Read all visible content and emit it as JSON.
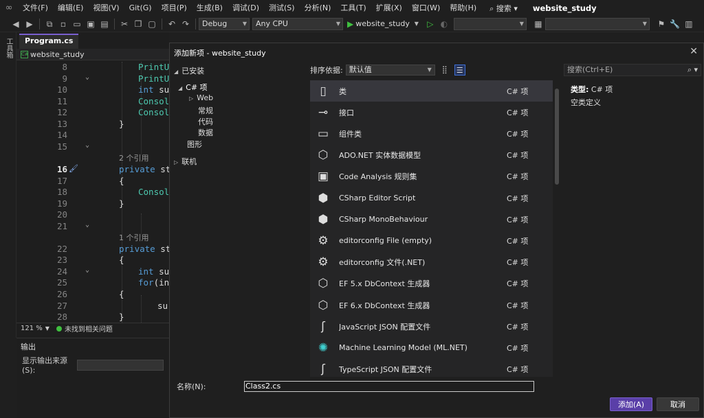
{
  "menubar": {
    "items": [
      "文件(F)",
      "编辑(E)",
      "视图(V)",
      "Git(G)",
      "项目(P)",
      "生成(B)",
      "调试(D)",
      "测试(S)",
      "分析(N)",
      "工具(T)",
      "扩展(X)",
      "窗口(W)",
      "帮助(H)"
    ],
    "search_label": "搜索",
    "app_title": "website_study"
  },
  "toolbar": {
    "config": "Debug",
    "platform": "Any CPU",
    "run_target": "website_study"
  },
  "side_panel_label": "工具箱",
  "editor": {
    "tab_name": "Program.cs",
    "nav_project": "website_study",
    "zoom": "121 %",
    "status": "未找到相关问题",
    "lines": [
      {
        "n": "8",
        "text": "PrintU"
      },
      {
        "n": "9",
        "text": "PrintU"
      },
      {
        "n": "10",
        "kw": "int",
        "text": " su"
      },
      {
        "n": "11",
        "text": "Consol"
      },
      {
        "n": "12",
        "text": "Consol"
      },
      {
        "n": "13",
        "text": "}"
      },
      {
        "n": "14",
        "text": ""
      },
      {
        "n": "15",
        "text": ""
      },
      {
        "refs": "2 个引用"
      },
      {
        "n": "16",
        "kw": "private",
        "text": " st",
        "current": true
      },
      {
        "n": "17",
        "text": "{"
      },
      {
        "n": "18",
        "text": "Consol"
      },
      {
        "n": "19",
        "text": "}"
      },
      {
        "n": "20",
        "text": ""
      },
      {
        "n": "21",
        "text": ""
      },
      {
        "refs": "1 个引用"
      },
      {
        "n": "22",
        "kw": "private",
        "text": " st"
      },
      {
        "n": "23",
        "text": "{"
      },
      {
        "n": "24",
        "kw": "int",
        "text": " su"
      },
      {
        "n": "25",
        "kw": "for",
        "text": "(in"
      },
      {
        "n": "26",
        "text": "{"
      },
      {
        "n": "27",
        "text": "su"
      },
      {
        "n": "28",
        "text": "}"
      }
    ]
  },
  "output": {
    "title": "输出",
    "source_label": "显示输出来源(S):"
  },
  "dialog": {
    "title": "添加新项 - website_study",
    "tree": {
      "installed": "已安装",
      "csharp": "C# 项",
      "web": "Web",
      "general": "常规",
      "code": "代码",
      "data": "数据",
      "graphics": "图形",
      "online": "联机"
    },
    "sort_label": "排序依据:",
    "sort_value": "默认值",
    "search_placeholder": "搜索(Ctrl+E)",
    "items": [
      {
        "name": "类",
        "type": "C# 项",
        "icon": "class-icon"
      },
      {
        "name": "接口",
        "type": "C# 项",
        "icon": "interface-icon"
      },
      {
        "name": "组件类",
        "type": "C# 项",
        "icon": "component-icon"
      },
      {
        "name": "ADO.NET 实体数据模型",
        "type": "C# 项",
        "icon": "entity-model-icon"
      },
      {
        "name": "Code Analysis 规则集",
        "type": "C# 项",
        "icon": "ruleset-icon"
      },
      {
        "name": "CSharp Editor Script",
        "type": "C# 项",
        "icon": "cube-icon"
      },
      {
        "name": "CSharp MonoBehaviour",
        "type": "C# 项",
        "icon": "cube-icon"
      },
      {
        "name": "editorconfig File (empty)",
        "type": "C# 项",
        "icon": "editorconfig-icon"
      },
      {
        "name": "editorconfig 文件(.NET)",
        "type": "C# 项",
        "icon": "editorconfig-icon"
      },
      {
        "name": "EF 5.x DbContext 生成器",
        "type": "C# 项",
        "icon": "dbcontext-icon"
      },
      {
        "name": "EF 6.x DbContext 生成器",
        "type": "C# 项",
        "icon": "dbcontext-icon"
      },
      {
        "name": "JavaScript JSON 配置文件",
        "type": "C# 项",
        "icon": "json-icon"
      },
      {
        "name": "Machine Learning Model (ML.NET)",
        "type": "C# 项",
        "icon": "ml-model-icon"
      },
      {
        "name": "TypeScript JSON 配置文件",
        "type": "C# 项",
        "icon": "json-icon"
      }
    ],
    "detail": {
      "type_label": "类型:",
      "type_value": "C# 项",
      "description": "空类定义"
    },
    "name_label": "名称(N):",
    "name_value": "Class2.cs",
    "add_label": "添加(A)",
    "cancel_label": "取消"
  }
}
